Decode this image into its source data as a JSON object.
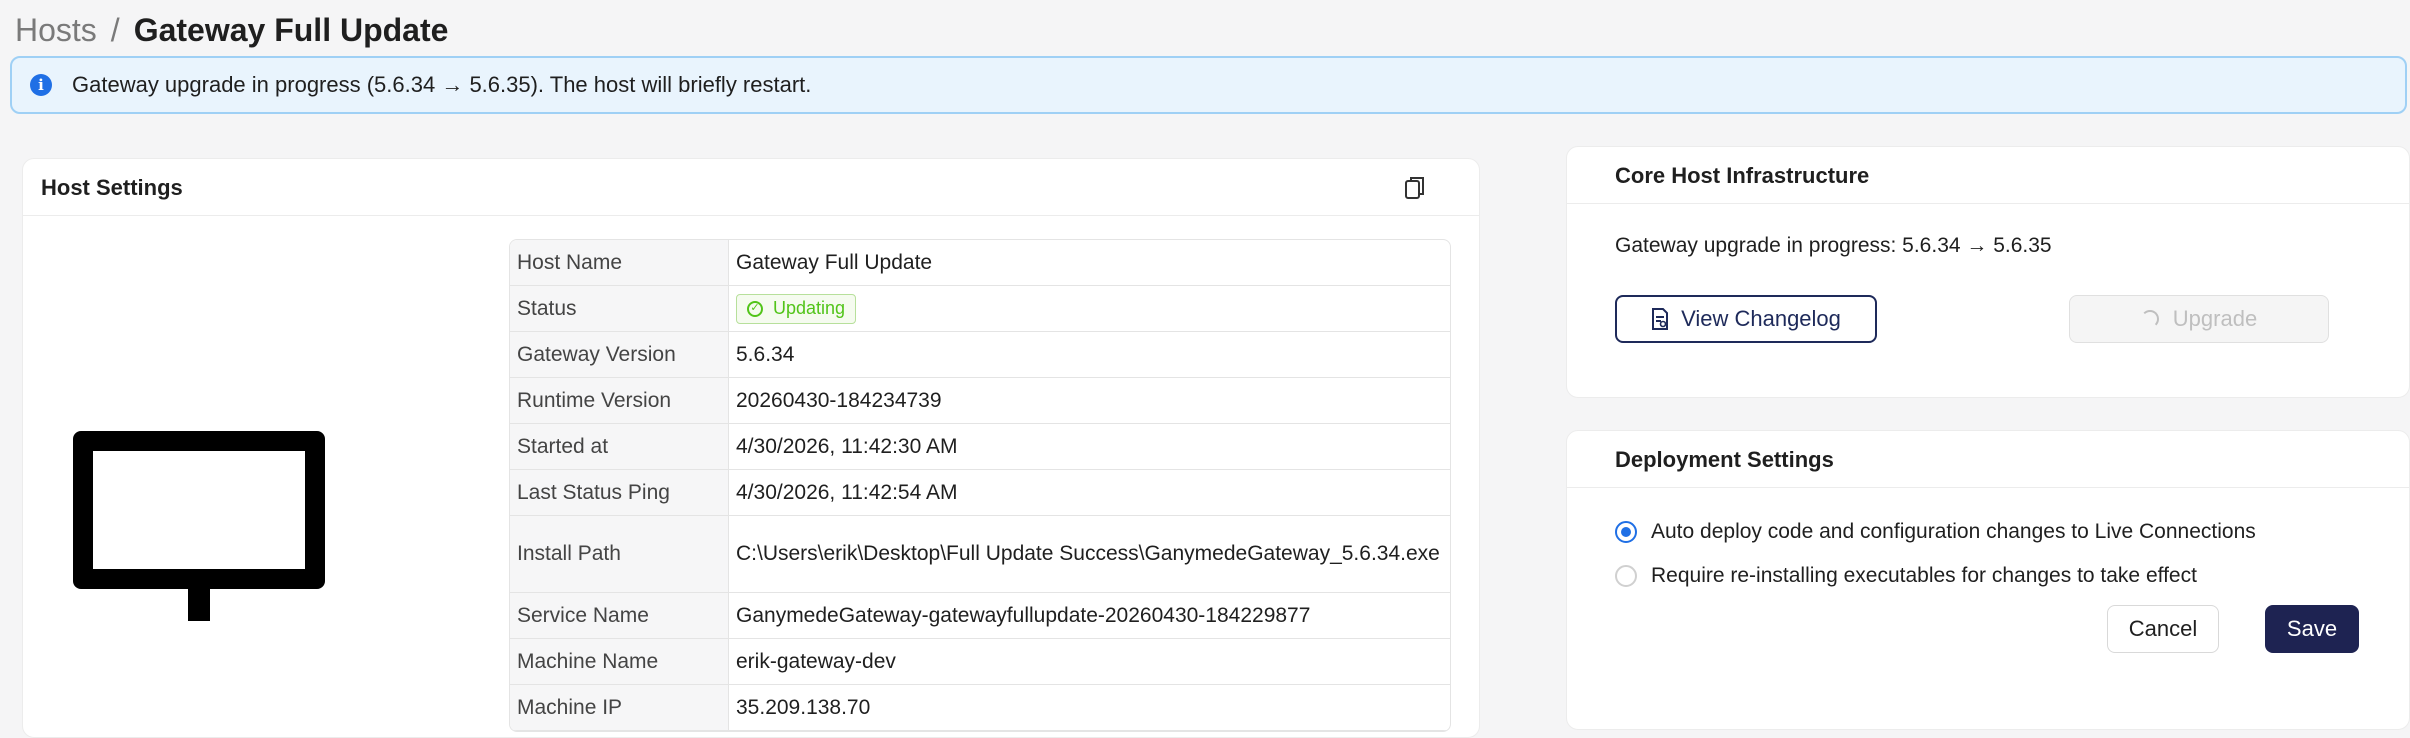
{
  "breadcrumb": {
    "root": "Hosts",
    "separator": "/",
    "current": "Gateway Full Update"
  },
  "alert": {
    "icon": "info-icon",
    "text": "Gateway upgrade in progress (5.6.34 → 5.6.35). The host will briefly restart."
  },
  "host_settings": {
    "title": "Host Settings",
    "copy_icon": "copy-icon",
    "rows": [
      {
        "key": "Host Name",
        "value": "Gateway Full Update"
      },
      {
        "key": "Status",
        "value": "Updating"
      },
      {
        "key": "Gateway Version",
        "value": "5.6.34"
      },
      {
        "key": "Runtime Version",
        "value": "20260430-184234739"
      },
      {
        "key": "Started at",
        "value": "4/30/2026, 11:42:30 AM"
      },
      {
        "key": "Last Status Ping",
        "value": "4/30/2026, 11:42:54 AM"
      },
      {
        "key": "Install Path",
        "value": "C:\\Users\\erik\\Desktop\\Full Update Success\\GanymedeGateway_5.6.34.exe"
      },
      {
        "key": "Service Name",
        "value": "GanymedeGateway-gatewayfullupdate-20260430-184229877"
      },
      {
        "key": "Machine Name",
        "value": "erik-gateway-dev"
      },
      {
        "key": "Machine IP",
        "value": "35.209.138.70"
      }
    ]
  },
  "core": {
    "title": "Core Host Infrastructure",
    "message": "Gateway upgrade in progress: 5.6.34 → 5.6.35",
    "changelog_label": "View Changelog",
    "upgrade_label": "Upgrade"
  },
  "deploy": {
    "title": "Deployment Settings",
    "options": [
      {
        "label": "Auto deploy code and configuration changes to Live Connections",
        "checked": true
      },
      {
        "label": "Require re-installing executables for changes to take effect",
        "checked": false
      }
    ],
    "cancel_label": "Cancel",
    "save_label": "Save"
  },
  "colors": {
    "accent": "#1f6fe5",
    "primary_button": "#1e2352",
    "success": "#52c41a",
    "alert_bg": "#e9f4fd"
  }
}
